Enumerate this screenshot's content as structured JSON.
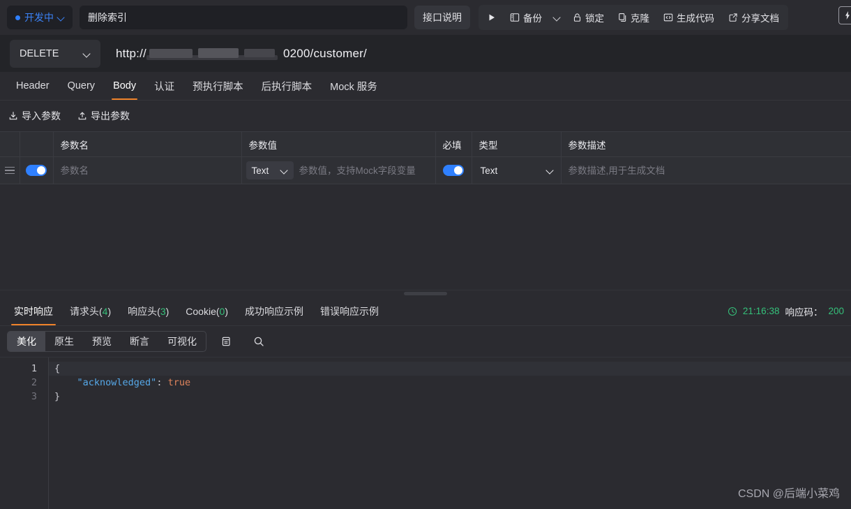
{
  "topbar": {
    "status_label": "开发中",
    "status_color": "#2f80ff",
    "title_value": "删除索引",
    "title_placeholder": "请输入接口名称",
    "desc_button": "接口说明",
    "tools": [
      {
        "label": "",
        "icon": "play-icon"
      },
      {
        "label": "备份",
        "icon": "backup-icon"
      },
      {
        "label": "",
        "icon": "chevron-down-icon"
      },
      {
        "label": "锁定",
        "icon": "lock-icon"
      },
      {
        "label": "克隆",
        "icon": "clone-icon"
      },
      {
        "label": "生成代码",
        "icon": "code-icon"
      },
      {
        "label": "分享文档",
        "icon": "share-icon"
      }
    ],
    "flash_icon": "flash-icon"
  },
  "url": {
    "method": "DELETE",
    "prefix": "http://",
    "redacted": true,
    "suffix": "0200/customer/"
  },
  "request_tabs": [
    {
      "label": "Header",
      "active": false
    },
    {
      "label": "Query",
      "active": false
    },
    {
      "label": "Body",
      "active": true
    },
    {
      "label": "认证",
      "active": false
    },
    {
      "label": "预执行脚本",
      "active": false
    },
    {
      "label": "后执行脚本",
      "active": false
    },
    {
      "label": "Mock 服务",
      "active": false
    }
  ],
  "param_actions": {
    "import": "导入参数",
    "export": "导出参数"
  },
  "params_table": {
    "headers": [
      "",
      "",
      "参数名",
      "参数值",
      "必填",
      "类型",
      "参数描述"
    ],
    "rows": [
      {
        "enabled": true,
        "name_placeholder": "参数名",
        "name_value": "",
        "value_type": "Text",
        "value_placeholder": "参数值，支持Mock字段变量",
        "value_value": "",
        "required": true,
        "type": "Text",
        "desc_placeholder": "参数描述,用于生成文档",
        "desc_value": ""
      }
    ]
  },
  "response_tabs": [
    {
      "label": "实时响应",
      "count": "",
      "active": true
    },
    {
      "label": "请求头",
      "count": "4",
      "active": false
    },
    {
      "label": "响应头",
      "count": "3",
      "active": false
    },
    {
      "label": "Cookie",
      "count": "0",
      "active": false
    },
    {
      "label": "成功响应示例",
      "count": "",
      "active": false
    },
    {
      "label": "错误响应示例",
      "count": "",
      "active": false
    }
  ],
  "response_meta": {
    "time": "21:16:38",
    "status_label": "响应码：",
    "status_code": "200"
  },
  "viewer": {
    "modes": [
      {
        "label": "美化",
        "active": true
      },
      {
        "label": "原生",
        "active": false
      },
      {
        "label": "预览",
        "active": false
      },
      {
        "label": "断言",
        "active": false
      },
      {
        "label": "可视化",
        "active": false
      }
    ],
    "copy_icon": "copy-icon",
    "search_icon": "search-icon"
  },
  "code": {
    "lines": [
      {
        "no": "1",
        "current": true,
        "tokens": [
          {
            "t": "{",
            "c": "punc"
          }
        ]
      },
      {
        "no": "2",
        "current": false,
        "tokens": [
          {
            "t": "    ",
            "c": "punc"
          },
          {
            "t": "\"acknowledged\"",
            "c": "key"
          },
          {
            "t": ": ",
            "c": "punc"
          },
          {
            "t": "true",
            "c": "bool"
          }
        ]
      },
      {
        "no": "3",
        "current": false,
        "tokens": [
          {
            "t": "}",
            "c": "punc"
          }
        ]
      }
    ]
  },
  "watermark": "CSDN @后端小菜鸡"
}
